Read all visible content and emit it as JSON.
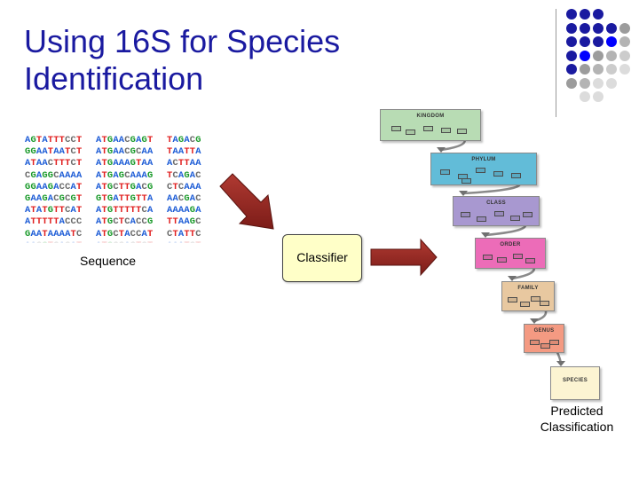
{
  "slide": {
    "title_lines": [
      "Using 16S for Species",
      "Identification"
    ],
    "title_color": "#1a1aa0"
  },
  "decoration": {
    "dot_grid": [
      [
        "#1a1aa0",
        "#1a1aa0",
        "#1a1aa0",
        null,
        null
      ],
      [
        "#1a1aa0",
        "#1a1aa0",
        "#1a1aa0",
        "#1a1aa0",
        "#9c9c9c"
      ],
      [
        "#1a1aa0",
        "#1a1aa0",
        "#1a1aa0",
        "#0000ff",
        "#b4b4b4"
      ],
      [
        "#1a1aa0",
        "#0000ff",
        "#9c9c9c",
        "#b4b4b4",
        "#cccccc"
      ],
      [
        "#1a1aa0",
        "#9c9c9c",
        "#b4b4b4",
        "#cccccc",
        "#dcdcdc"
      ],
      [
        "#9c9c9c",
        "#b4b4b4",
        "#dcdcdc",
        "#dcdcdc",
        null
      ],
      [
        null,
        "#dcdcdc",
        "#dcdcdc",
        null,
        null
      ]
    ]
  },
  "sequence": {
    "columns": [
      [
        "AGTATTTCCT",
        "GGAATAATCT",
        "ATAACTTTCT",
        "CGAGGCAAAA",
        "GGAAGACCAT",
        "GAAGACGCGT",
        "ATATGTTCAT",
        "ATTTTTACCC",
        "GAATAAAATC",
        "AACGTCACAT"
      ],
      [
        "ATGAACGAGT",
        "ATGAACGCAA",
        "ATGAAAGTAA",
        "ATGAGCAAAG",
        "ATGCTTGACG",
        "GTGATTGTTA",
        "ATGTTTTTCA",
        "ATGCTCACCG",
        "ATGCTACCAT",
        "ATGCCACTCT"
      ],
      [
        "TAGACG",
        "TAATTA",
        "ACTTAA",
        "TCAGAC",
        "CTCAAA",
        "AACGAC",
        "AAAAGA",
        "TTAAGC",
        "CTATTC",
        "AAATCT"
      ]
    ],
    "label": "Sequence"
  },
  "classifier": {
    "label": "Classifier",
    "fill": "#ffffc8"
  },
  "taxonomy": {
    "levels": [
      {
        "name": "Kingdom",
        "display": "KINGDOM",
        "color": "#b8dcb4"
      },
      {
        "name": "Phylum",
        "display": "PHYLUM",
        "color": "#62bcd8"
      },
      {
        "name": "Class",
        "display": "CLASS",
        "color": "#a898d0"
      },
      {
        "name": "Order",
        "display": "ORDER",
        "color": "#ec6cb8"
      },
      {
        "name": "Family",
        "display": "FAMILY",
        "color": "#e8c8a0"
      },
      {
        "name": "Genus",
        "display": "GENUS",
        "color": "#f49a82"
      },
      {
        "name": "Species",
        "display": "SPECIES",
        "color": "#fcf4d2"
      }
    ],
    "result_label_lines": [
      "Predicted",
      "Classification"
    ]
  },
  "arrows": {
    "color": "#9a2a24"
  }
}
